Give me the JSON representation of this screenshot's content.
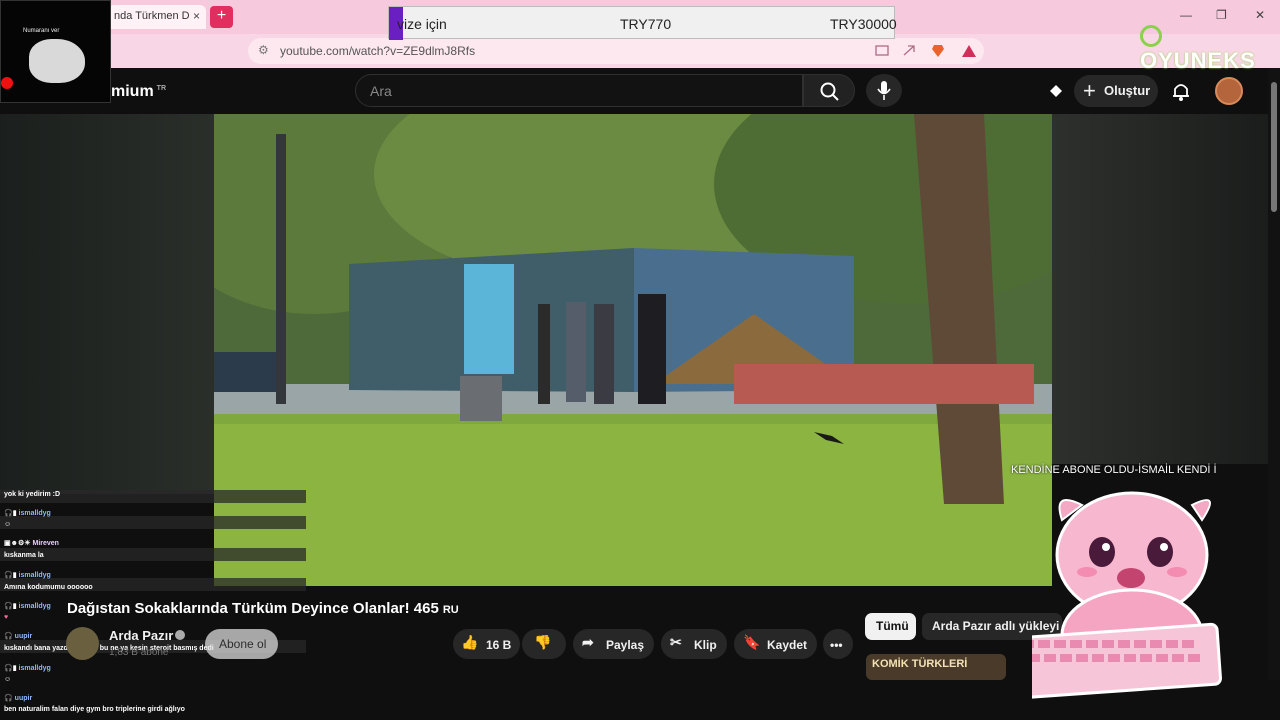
{
  "browser": {
    "tab_title": "nda Türkmen D",
    "tab_close": "×",
    "new_tab": "+",
    "url": "youtube.com/watch?v=ZE9dlmJ8Rfs",
    "window_controls": [
      "—",
      "❐",
      "✕"
    ]
  },
  "overlay_price": {
    "label": "vize için",
    "price_low": "TRY770",
    "price_high": "TRY30000",
    "accent": "#6a1fc2"
  },
  "sponsor_logo": "OYUNEKS",
  "webcam": {
    "label": "Numaranı ver"
  },
  "youtube": {
    "brand": "mium",
    "brand_region": "TR",
    "search_placeholder": "Ara",
    "create_label": "Oluştur"
  },
  "video": {
    "title": "Dağıstan Sokaklarında Türküm Deyince Olanlar! 465",
    "title_badge": "RU",
    "channel_name": "Arda Pazır",
    "subscribers": "1,83 B abone",
    "subscribe_label": "Abone ol",
    "likes": "16 B",
    "share_label": "Paylaş",
    "clip_label": "Klip",
    "save_label": "Kaydet",
    "more_label": "•••"
  },
  "related": {
    "chip_all": "Tümü",
    "chip_channel": "Arda Pazır adlı yükleyi",
    "thumb_text": "KOMİK TÜRKLERİ"
  },
  "chat": [
    {
      "user": "",
      "text": "yok ki yedirim :D"
    },
    {
      "user": "ismalldyg",
      "text": ""
    },
    {
      "user": "Mireven",
      "text": "kıskanma la"
    },
    {
      "user": "ismalldyg",
      "text": "Amına kodumumu oooooo"
    },
    {
      "user": "ismalldyg",
      "text": ""
    },
    {
      "user": "uupir",
      "text": "kıskandı bana yazdı özelden bu ne ya kesin steroit basmış dedi"
    },
    {
      "user": "ismalldyg",
      "text": ""
    },
    {
      "user": "uupir",
      "text": "ben naturalim falan diye gym bro triplerine girdi ağlıyo"
    }
  ],
  "follow_alert": "KENDİNE ABONE OLDU-İSMAİL KENDİ İ",
  "icons": [
    "search-icon",
    "mic-icon",
    "create-icon",
    "bell-icon",
    "like-icon",
    "dislike-icon",
    "share-icon",
    "scissors-icon",
    "bookmark-icon"
  ]
}
